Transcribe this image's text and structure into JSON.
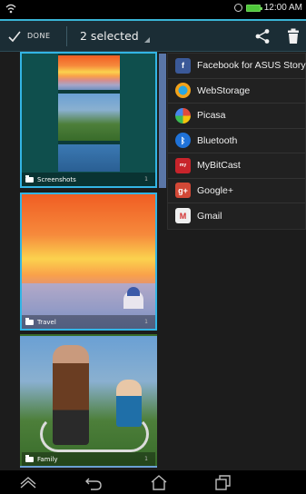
{
  "status_bar": {
    "time": "12:00 AM",
    "icons": [
      "wifi-icon",
      "alarm-icon",
      "battery-icon"
    ]
  },
  "action_bar": {
    "done_label": "DONE",
    "selection_label": "2 selected",
    "accent_color": "#33b5e5",
    "icons": [
      "check-icon",
      "share-icon",
      "trash-icon"
    ]
  },
  "albums": [
    {
      "name": "Screenshots",
      "count": "1",
      "selected": true
    },
    {
      "name": "Travel",
      "count": "1",
      "selected": true
    },
    {
      "name": "Family",
      "count": "1",
      "selected": false
    }
  ],
  "share_menu": {
    "items": [
      {
        "label": "Facebook for ASUS Story",
        "icon": "facebook-asus-story-icon",
        "color": "#3b5998"
      },
      {
        "label": "WebStorage",
        "icon": "webstorage-icon",
        "color": "#f2a21a"
      },
      {
        "label": "Picasa",
        "icon": "picasa-icon",
        "color": "#e14b3c"
      },
      {
        "label": "Bluetooth",
        "icon": "bluetooth-icon",
        "color": "#1f72d8"
      },
      {
        "label": "MyBitCast",
        "icon": "mybitcast-icon",
        "color": "#c8242b"
      },
      {
        "label": "Google+",
        "icon": "google-plus-icon",
        "color": "#d34836"
      },
      {
        "label": "Gmail",
        "icon": "gmail-icon",
        "color": "#e8e8e8"
      }
    ]
  },
  "nav_bar": {
    "icons": [
      "collapse-icon",
      "back-icon",
      "home-icon",
      "recent-apps-icon"
    ]
  }
}
